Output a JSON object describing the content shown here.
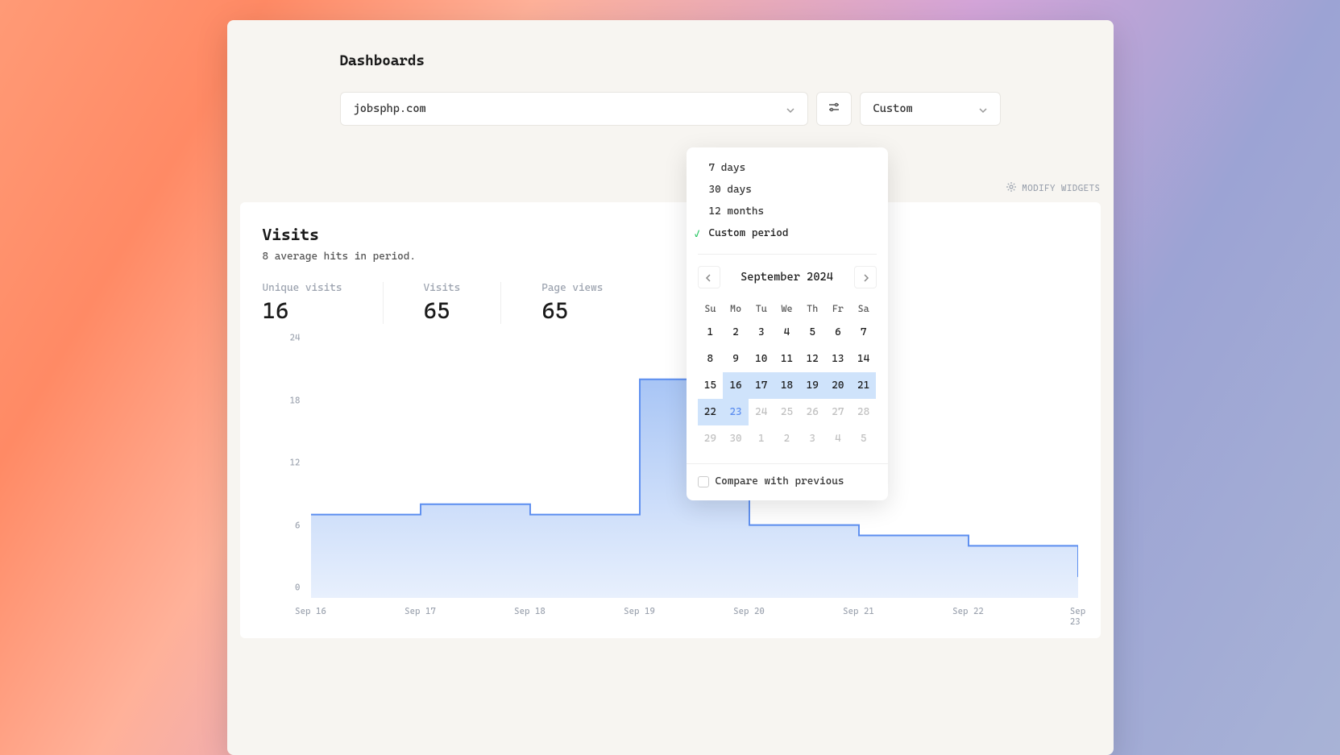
{
  "page_title": "Dashboards",
  "site_selector": {
    "value": "jobsphp.com"
  },
  "period_selector": {
    "value": "Custom"
  },
  "modify_widgets_label": "MODIFY WIDGETS",
  "dropdown": {
    "options": [
      {
        "label": "7 days",
        "selected": false
      },
      {
        "label": "30 days",
        "selected": false
      },
      {
        "label": "12 months",
        "selected": false
      },
      {
        "label": "Custom period",
        "selected": true
      }
    ],
    "compare_label": "Compare with previous"
  },
  "calendar": {
    "month_label": "September 2024",
    "dow": [
      "Su",
      "Mo",
      "Tu",
      "We",
      "Th",
      "Fr",
      "Sa"
    ],
    "days": [
      {
        "n": 1
      },
      {
        "n": 2
      },
      {
        "n": 3
      },
      {
        "n": 4
      },
      {
        "n": 5
      },
      {
        "n": 6
      },
      {
        "n": 7
      },
      {
        "n": 8
      },
      {
        "n": 9
      },
      {
        "n": 10
      },
      {
        "n": 11
      },
      {
        "n": 12
      },
      {
        "n": 13
      },
      {
        "n": 14
      },
      {
        "n": 15
      },
      {
        "n": 16,
        "r": true
      },
      {
        "n": 17,
        "r": true
      },
      {
        "n": 18,
        "r": true
      },
      {
        "n": 19,
        "r": true
      },
      {
        "n": 20,
        "r": true
      },
      {
        "n": 21,
        "r": true
      },
      {
        "n": 22,
        "r": true
      },
      {
        "n": 23,
        "r": true,
        "t": true
      },
      {
        "n": 24,
        "m": true
      },
      {
        "n": 25,
        "m": true
      },
      {
        "n": 26,
        "m": true
      },
      {
        "n": 27,
        "m": true
      },
      {
        "n": 28,
        "m": true
      },
      {
        "n": 29,
        "m": true
      },
      {
        "n": 30,
        "m": true
      },
      {
        "n": 1,
        "m": true
      },
      {
        "n": 2,
        "m": true
      },
      {
        "n": 3,
        "m": true
      },
      {
        "n": 4,
        "m": true
      },
      {
        "n": 5,
        "m": true
      }
    ]
  },
  "card": {
    "title": "Visits",
    "subtitle": "8 average hits in period.",
    "metrics": [
      {
        "label": "Unique visits",
        "value": "16"
      },
      {
        "label": "Visits",
        "value": "65"
      },
      {
        "label": "Page views",
        "value": "65"
      }
    ]
  },
  "chart_data": {
    "type": "area",
    "title": "Visits",
    "xlabel": "",
    "ylabel": "",
    "ylim": [
      0,
      24
    ],
    "y_ticks": [
      24,
      18,
      12,
      6,
      0
    ],
    "categories": [
      "Sep 16",
      "Sep 17",
      "Sep 18",
      "Sep 19",
      "Sep 20",
      "Sep 21",
      "Sep 22",
      "Sep 23"
    ],
    "values": [
      8,
      9,
      8,
      21,
      7,
      6,
      5,
      2
    ]
  }
}
